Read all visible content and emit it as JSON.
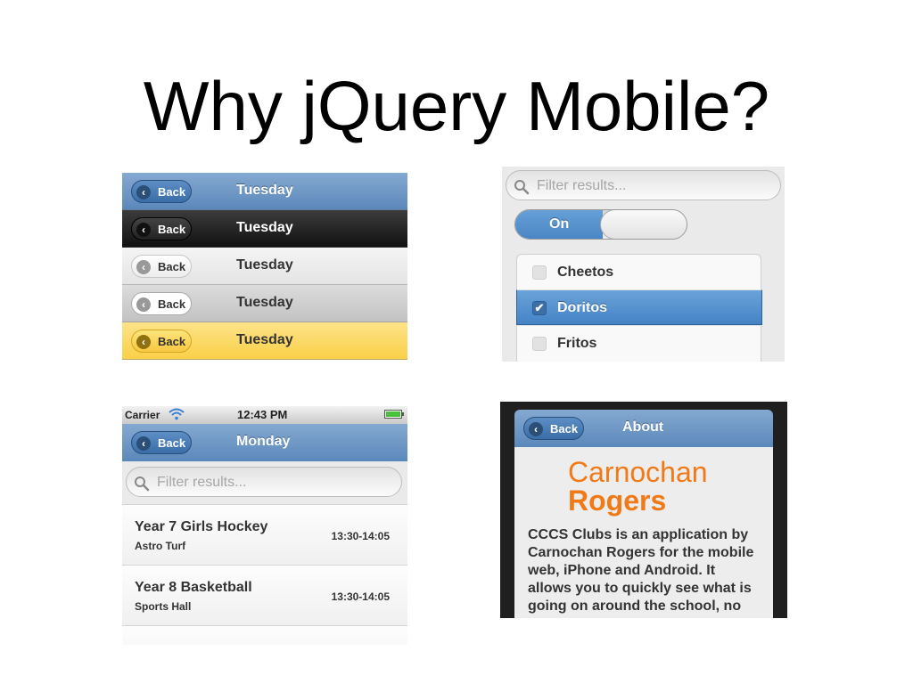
{
  "slide": {
    "title": "Why jQuery Mobile?"
  },
  "toolbars": {
    "rows": [
      {
        "back_label": "Back",
        "title": "Tuesday"
      },
      {
        "back_label": "Back",
        "title": "Tuesday"
      },
      {
        "back_label": "Back",
        "title": "Tuesday"
      },
      {
        "back_label": "Back",
        "title": "Tuesday"
      },
      {
        "back_label": "Back",
        "title": "Tuesday"
      }
    ]
  },
  "form": {
    "search_placeholder": "Filter results...",
    "flip_switch_label": "On",
    "checkboxes": [
      {
        "label": "Cheetos",
        "checked": false
      },
      {
        "label": "Doritos",
        "checked": true
      },
      {
        "label": "Fritos",
        "checked": false
      }
    ]
  },
  "list_app": {
    "status": {
      "carrier": "Carrier",
      "time": "12:43 PM"
    },
    "header": {
      "back_label": "Back",
      "title": "Monday"
    },
    "search_placeholder": "Filter results...",
    "items": [
      {
        "title": "Year 7 Girls Hockey",
        "subtitle": "Astro Turf",
        "time": "13:30-14:05"
      },
      {
        "title": "Year 8 Basketball",
        "subtitle": "Sports Hall",
        "time": "13:30-14:05"
      }
    ]
  },
  "about_app": {
    "header": {
      "back_label": "Back",
      "title": "About"
    },
    "logo": {
      "line1": "Carnochan",
      "line2": "Rogers"
    },
    "lines": [
      "CCCS Clubs is an application by",
      "Carnochan Rogers for the mobile",
      "web, iPhone and Android. It",
      "allows you to quickly see what is",
      "going on around the school, no"
    ]
  },
  "colors": {
    "theme_blue": "#5b88bb",
    "accent_orange": "#f07a18",
    "theme_yellow": "#f9d048",
    "theme_black": "#111111"
  }
}
